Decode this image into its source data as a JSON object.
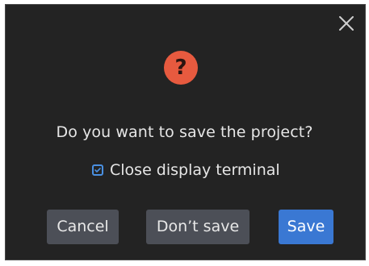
{
  "dialog": {
    "close_icon": "close-icon",
    "question_icon": "question-icon",
    "question_glyph": "?",
    "message": "Do you want to save the project?",
    "option": {
      "label": "Close display terminal",
      "checked": true
    },
    "buttons": {
      "cancel": "Cancel",
      "dont_save": "Don’t save",
      "save": "Save"
    },
    "colors": {
      "background": "#232323",
      "accent": "#3a78d3",
      "question_badge": "#e75a3f",
      "secondary_button": "#4c4f57"
    }
  }
}
